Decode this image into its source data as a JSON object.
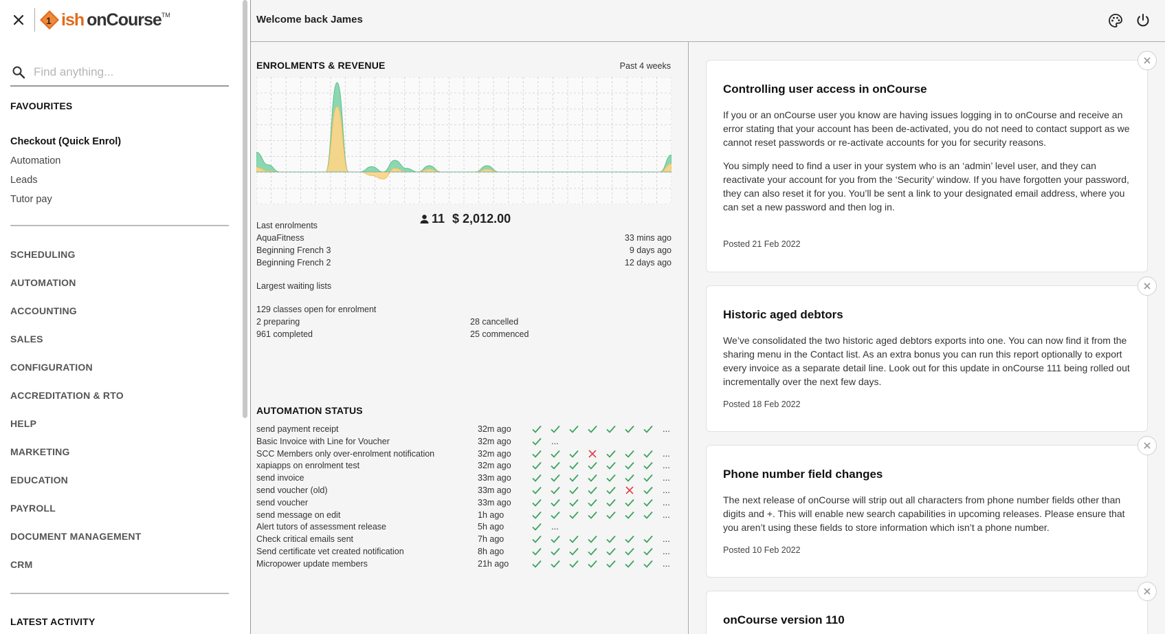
{
  "app": {
    "logo_brand": "ish",
    "logo_product": "onCourse",
    "logo_tm": "TM"
  },
  "sidebar": {
    "search_placeholder": "Find anything...",
    "favourites_title": "FAVOURITES",
    "favourites": [
      "Checkout (Quick Enrol)",
      "Automation",
      "Leads",
      "Tutor pay"
    ],
    "categories": [
      "SCHEDULING",
      "AUTOMATION",
      "ACCOUNTING",
      "SALES",
      "CONFIGURATION",
      "ACCREDITATION & RTO",
      "HELP",
      "MARKETING",
      "EDUCATION",
      "PAYROLL",
      "DOCUMENT MANAGEMENT",
      "CRM"
    ],
    "latest_title": "LATEST ACTIVITY"
  },
  "header": {
    "welcome": "Welcome back James"
  },
  "enrolments": {
    "title": "ENROLMENTS & REVENUE",
    "period": "Past 4 weeks",
    "total_enrolments": "11",
    "total_revenue": "$ 2,012.00",
    "last_enrolments_label": "Last enrolments",
    "last_enrolments": [
      {
        "name": "AquaFitness",
        "ago": "33 mins ago"
      },
      {
        "name": "Beginning French 3",
        "ago": "9 days ago"
      },
      {
        "name": "Beginning French 2",
        "ago": "12 days ago"
      }
    ],
    "waiting_label": "Largest waiting lists",
    "classes_open": "129 classes open for enrolment",
    "preparing": "2 preparing",
    "cancelled": "28 cancelled",
    "completed": "961 completed",
    "commenced": "25 commenced"
  },
  "chart_data": {
    "type": "area",
    "title": "ENROLMENTS & REVENUE",
    "series": [
      {
        "name": "",
        "color": "#7fd3a8",
        "values": [
          0.22,
          0.08,
          0,
          0,
          0,
          0,
          0,
          1.0,
          0,
          0,
          0.06,
          0,
          0.13,
          0.04,
          0,
          0.07,
          0,
          0,
          0,
          0,
          0.07,
          0,
          0,
          0,
          0,
          0,
          0,
          0,
          0,
          0,
          0,
          0,
          0,
          0,
          0,
          0,
          0.19
        ]
      },
      {
        "name": "",
        "color": "#f9d58a",
        "values": [
          0.05,
          0.01,
          0,
          0,
          0,
          0,
          0,
          0.73,
          0,
          0,
          -0.04,
          -0.08,
          0.04,
          0,
          0,
          0.03,
          0,
          0,
          0,
          0,
          0.03,
          0,
          0,
          0,
          0,
          0,
          0,
          0,
          0,
          0,
          0,
          0,
          0,
          0,
          0,
          0,
          0.09
        ]
      }
    ],
    "grid": true
  },
  "automation": {
    "title": "AUTOMATION STATUS",
    "rows": [
      {
        "name": "send payment receipt",
        "time": "32m ago",
        "status": [
          "ok",
          "ok",
          "ok",
          "ok",
          "ok",
          "ok",
          "ok",
          "more"
        ]
      },
      {
        "name": "Basic Invoice with Line for Voucher",
        "time": "32m ago",
        "status": [
          "ok",
          "more"
        ]
      },
      {
        "name": "SCC Members only over-enrolment notification",
        "time": "32m ago",
        "status": [
          "ok",
          "ok",
          "ok",
          "fail",
          "ok",
          "ok",
          "ok",
          "more"
        ]
      },
      {
        "name": "xapiapps on enrolment test",
        "time": "32m ago",
        "status": [
          "ok",
          "ok",
          "ok",
          "ok",
          "ok",
          "ok",
          "ok",
          "more"
        ]
      },
      {
        "name": "send invoice",
        "time": "33m ago",
        "status": [
          "ok",
          "ok",
          "ok",
          "ok",
          "ok",
          "ok",
          "ok",
          "more"
        ]
      },
      {
        "name": "send voucher (old)",
        "time": "33m ago",
        "status": [
          "ok",
          "ok",
          "ok",
          "ok",
          "ok",
          "fail",
          "ok",
          "more"
        ]
      },
      {
        "name": "send voucher",
        "time": "33m ago",
        "status": [
          "ok",
          "ok",
          "ok",
          "ok",
          "ok",
          "ok",
          "ok",
          "more"
        ]
      },
      {
        "name": "send message on edit",
        "time": "1h ago",
        "status": [
          "ok",
          "ok",
          "ok",
          "ok",
          "ok",
          "ok",
          "ok",
          "more"
        ]
      },
      {
        "name": "Alert tutors of assessment release",
        "time": "5h ago",
        "status": [
          "ok",
          "more"
        ]
      },
      {
        "name": "Check critical emails sent",
        "time": "7h ago",
        "status": [
          "ok",
          "ok",
          "ok",
          "ok",
          "ok",
          "ok",
          "ok",
          "more"
        ]
      },
      {
        "name": "Send certificate vet created notification",
        "time": "8h ago",
        "status": [
          "ok",
          "ok",
          "ok",
          "ok",
          "ok",
          "ok",
          "ok",
          "more"
        ]
      },
      {
        "name": "Micropower update members",
        "time": "21h ago",
        "status": [
          "ok",
          "ok",
          "ok",
          "ok",
          "ok",
          "ok",
          "ok",
          "more"
        ]
      }
    ],
    "more_text": "..."
  },
  "news": [
    {
      "title": "Controlling user access in onCourse",
      "body": [
        "If you or an onCourse user you know are having issues logging in to onCourse and receive an error stating that your account has been de-activated, you do not need to contact support as we cannot reset passwords or re-activate accounts for you for security reasons.",
        "You simply need to find a user in your system who is an ‘admin’ level user, and they can reactivate your account for you from the ‘Security’ window. If you have forgotten your password, they can also reset it for you. You’ll be sent a link to your designated email address, where you can set a new password and then log in."
      ],
      "date": "Posted 21 Feb 2022"
    },
    {
      "title": "Historic aged debtors",
      "body": [
        "We’ve consolidated the two historic aged debtors exports into one. You can now find it from the sharing menu in the Contact list. As an extra bonus you can run this report optionally to export every invoice as a separate detail line. Look out for this update in onCourse 111 being rolled out incrementally over the next few days."
      ],
      "date": "Posted 18 Feb 2022"
    },
    {
      "title": "Phone number field changes",
      "body": [
        "The next release of onCourse will strip out all characters from phone number fields other than digits and +. This will enable new search capabilities in upcoming releases. Please ensure that you aren’t using these fields to store information which isn’t a phone number."
      ],
      "date": "Posted 10 Feb 2022"
    },
    {
      "title": "onCourse version 110",
      "body": [],
      "date": ""
    }
  ],
  "colors": {
    "ok": "#3aa35b",
    "fail": "#e0404a",
    "accent": "#e06c1f",
    "enrol": "#7fd3a8",
    "revenue": "#f9d58a"
  }
}
